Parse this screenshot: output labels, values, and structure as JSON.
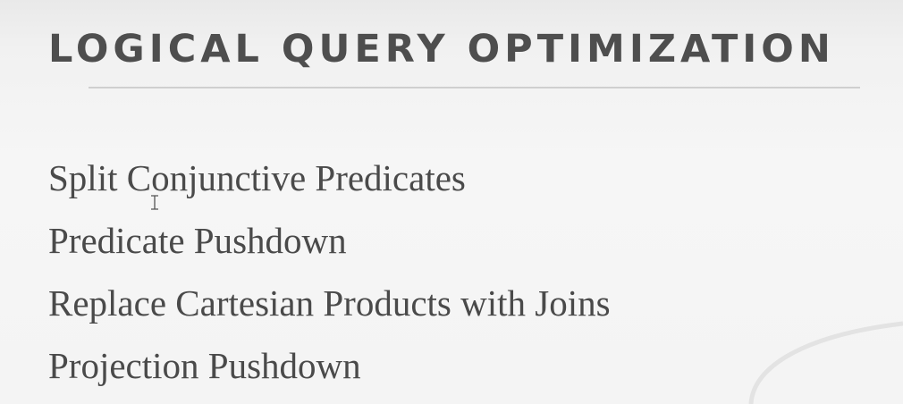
{
  "slide": {
    "title": "LOGICAL QUERY OPTIMIZATION",
    "items": [
      "Split Conjunctive Predicates",
      "Predicate Pushdown",
      "Replace Cartesian Products with Joins",
      "Projection Pushdown"
    ]
  },
  "colors": {
    "title": "#4e4e4e",
    "text": "#4a4a4a",
    "rule": "#cfcfcf",
    "background": "#f4f4f4"
  },
  "icons": {
    "cursor": "text-cursor-icon",
    "decoration": "swoosh-decoration"
  }
}
